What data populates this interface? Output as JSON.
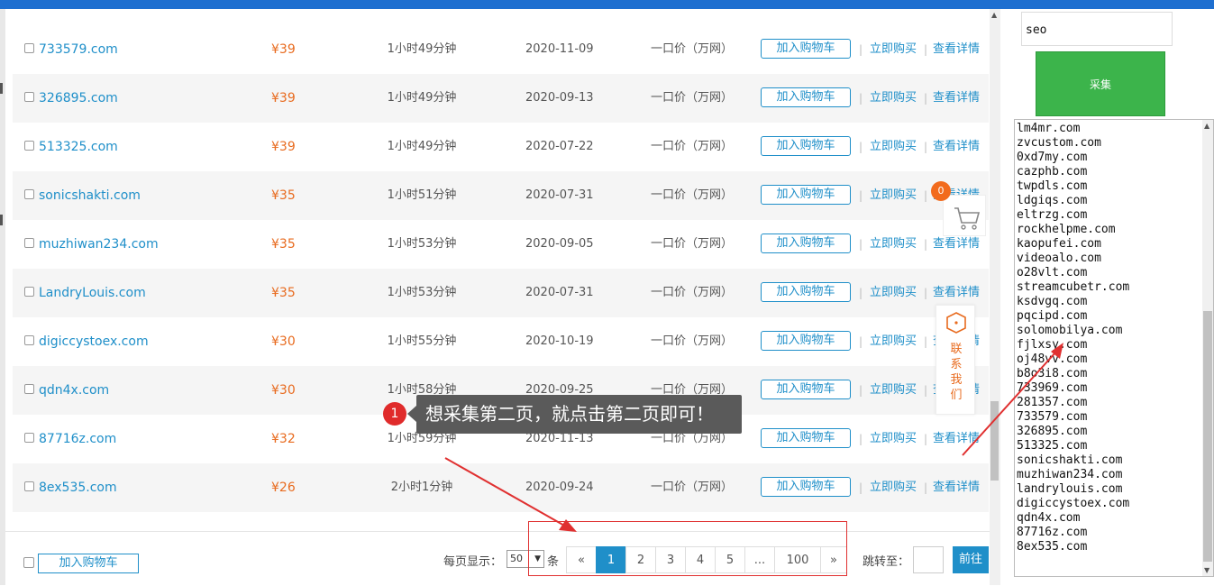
{
  "rows": [
    {
      "domain": "733579.com",
      "price": "¥39",
      "time": "1小时49分钟",
      "date": "2020-11-09",
      "type": "一口价（万网）"
    },
    {
      "domain": "326895.com",
      "price": "¥39",
      "time": "1小时49分钟",
      "date": "2020-09-13",
      "type": "一口价（万网）"
    },
    {
      "domain": "513325.com",
      "price": "¥39",
      "time": "1小时49分钟",
      "date": "2020-07-22",
      "type": "一口价（万网）"
    },
    {
      "domain": "sonicshakti.com",
      "price": "¥35",
      "time": "1小时51分钟",
      "date": "2020-07-31",
      "type": "一口价（万网）"
    },
    {
      "domain": "muzhiwan234.com",
      "price": "¥35",
      "time": "1小时53分钟",
      "date": "2020-09-05",
      "type": "一口价（万网）"
    },
    {
      "domain": "LandryLouis.com",
      "price": "¥35",
      "time": "1小时53分钟",
      "date": "2020-07-31",
      "type": "一口价（万网）"
    },
    {
      "domain": "digiccystoex.com",
      "price": "¥30",
      "time": "1小时55分钟",
      "date": "2020-10-19",
      "type": "一口价（万网）"
    },
    {
      "domain": "qdn4x.com",
      "price": "¥30",
      "time": "1小时58分钟",
      "date": "2020-09-25",
      "type": "一口价（万网）"
    },
    {
      "domain": "87716z.com",
      "price": "¥32",
      "time": "1小时59分钟",
      "date": "2020-11-13",
      "type": "一口价（万网）"
    },
    {
      "domain": "8ex535.com",
      "price": "¥26",
      "time": "2小时1分钟",
      "date": "2020-09-24",
      "type": "一口价（万网）"
    }
  ],
  "actions": {
    "add_cart": "加入购物车",
    "buy_now": "立即购买",
    "details": "查看详情",
    "separator": "|"
  },
  "footer": {
    "add_cart": "加入购物车",
    "per_page_label": "每页显示：",
    "per_page_value": "50",
    "per_page_unit": "条",
    "pages": [
      "«",
      "1",
      "2",
      "3",
      "4",
      "5",
      "...",
      "100",
      "»"
    ],
    "active_page": "1",
    "jump_label": "跳转至：",
    "go_label": "前往"
  },
  "tooltip": {
    "step": "1",
    "text": "想采集第二页，就点击第二页即可！"
  },
  "side": {
    "search_value": "seo",
    "collect_label": "采集",
    "results": [
      "lm4mr.com",
      "zvcustom.com",
      "0xd7my.com",
      "cazphb.com",
      "twpdls.com",
      "ldgiqs.com",
      "eltrzg.com",
      "rockhelpme.com",
      "kaopufei.com",
      "videoalo.com",
      "o28vlt.com",
      "streamcubetr.com",
      "ksdvgq.com",
      "pqcipd.com",
      "solomobilya.com",
      "fjlxsy.com",
      "oj48vv.com",
      "b8o3i8.com",
      "733969.com",
      "281357.com",
      "733579.com",
      "326895.com",
      "513325.com",
      "sonicshakti.com",
      "muzhiwan234.com",
      "landrylouis.com",
      "digiccystoex.com",
      "qdn4x.com",
      "87716z.com",
      "8ex535.com"
    ],
    "cart_count": "0",
    "contact_label": [
      "联",
      "系",
      "我",
      "们"
    ]
  },
  "colors": {
    "accent": "#1f8fc9",
    "price": "#e86b1f",
    "collect": "#3cb44b",
    "annotation": "#e03030",
    "topbar": "#1e6fd0"
  }
}
